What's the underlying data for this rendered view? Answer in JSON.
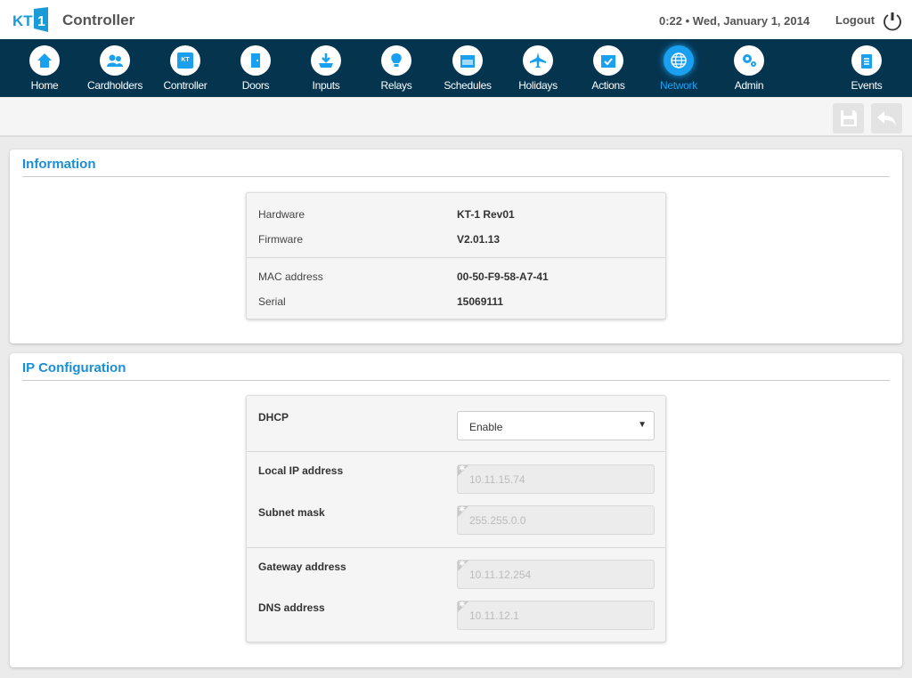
{
  "header": {
    "logo_text": "KT1",
    "title": "Controller",
    "clock": "0:22 • Wed, January 1, 2014",
    "logout_label": "Logout"
  },
  "nav": {
    "items": [
      {
        "label": "Home",
        "icon": "home-icon"
      },
      {
        "label": "Cardholders",
        "icon": "users-icon"
      },
      {
        "label": "Controller",
        "icon": "controller-icon",
        "glyph": "KT"
      },
      {
        "label": "Doors",
        "icon": "door-icon"
      },
      {
        "label": "Inputs",
        "icon": "input-icon"
      },
      {
        "label": "Relays",
        "icon": "lightbulb-icon"
      },
      {
        "label": "Schedules",
        "icon": "calendar-icon"
      },
      {
        "label": "Holidays",
        "icon": "airplane-icon"
      },
      {
        "label": "Actions",
        "icon": "calendar-check-icon"
      },
      {
        "label": "Network",
        "icon": "globe-icon",
        "active": true
      },
      {
        "label": "Admin",
        "icon": "gears-icon"
      },
      {
        "label": "Events",
        "icon": "clipboard-icon"
      }
    ],
    "active": "Network",
    "accent": "#1aa0f0",
    "background": "#05344f"
  },
  "toolbar": {
    "save_icon": "save-icon",
    "undo_icon": "undo-icon"
  },
  "information": {
    "title": "Information",
    "rows": [
      {
        "label": "Hardware",
        "value": "KT-1 Rev01"
      },
      {
        "label": "Firmware",
        "value": "V2.01.13"
      },
      {
        "label": "MAC address",
        "value": "00-50-F9-58-A7-41"
      },
      {
        "label": "Serial",
        "value": "15069111"
      }
    ]
  },
  "ip_config": {
    "title": "IP Configuration",
    "dhcp": {
      "label": "DHCP",
      "value": "Enable"
    },
    "fields": [
      {
        "label": "Local IP address",
        "value": "10.11.15.74"
      },
      {
        "label": "Subnet mask",
        "value": "255.255.0.0"
      },
      {
        "label": "Gateway address",
        "value": "10.11.12.254"
      },
      {
        "label": "DNS address",
        "value": "10.11.12.1"
      }
    ]
  }
}
